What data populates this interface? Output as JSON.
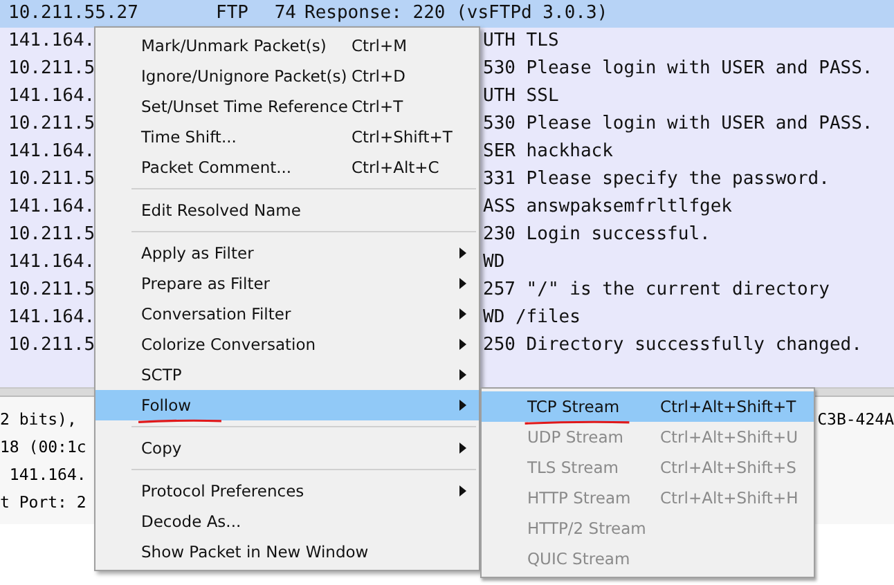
{
  "packet_list": {
    "rows": [
      {
        "source": "10.211.55.27",
        "protocol": "FTP",
        "length": "74",
        "info": "Response: 220 (vsFTPd 3.0.3)",
        "selected": true
      },
      {
        "source": "141.164.",
        "info": "UTH TLS",
        "selected": false
      },
      {
        "source": "10.211.5",
        "info": "530 Please login with USER and PASS.",
        "selected": false
      },
      {
        "source": "141.164.",
        "info": "UTH SSL",
        "selected": false
      },
      {
        "source": "10.211.5",
        "info": "530 Please login with USER and PASS.",
        "selected": false
      },
      {
        "source": "141.164.",
        "info": "SER hackhack",
        "selected": false
      },
      {
        "source": "10.211.5",
        "info": "331 Please specify the password.",
        "selected": false
      },
      {
        "source": "141.164.",
        "info": "ASS answpaksemfrltlfgek",
        "selected": false
      },
      {
        "source": "10.211.5",
        "info": "230 Login successful.",
        "selected": false
      },
      {
        "source": "141.164.",
        "info": "WD",
        "selected": false
      },
      {
        "source": "10.211.5",
        "info": "257 \"/\" is the current directory",
        "selected": false
      },
      {
        "source": "141.164.",
        "info": "WD /files",
        "selected": false
      },
      {
        "source": "10.211.5",
        "info": "250 Directory successfully changed.",
        "selected": false
      }
    ]
  },
  "details_pane": {
    "lines": [
      {
        "column_1": "2 bits),",
        "column_2": "C3B-424A"
      },
      {
        "column_1": "18 (00:1c"
      },
      {
        "column_1": " 141.164."
      },
      {
        "column_1": "t Port: 2"
      }
    ]
  },
  "context_menu": {
    "items": [
      {
        "kind": "item",
        "label": "Mark/Unmark Packet(s)",
        "shortcut": "Ctrl+M",
        "submenu": false,
        "selected": false,
        "underlined": false
      },
      {
        "kind": "item",
        "label": "Ignore/Unignore Packet(s)",
        "shortcut": "Ctrl+D",
        "submenu": false,
        "selected": false,
        "underlined": false
      },
      {
        "kind": "item",
        "label": "Set/Unset Time Reference",
        "shortcut": "Ctrl+T",
        "submenu": false,
        "selected": false,
        "underlined": false
      },
      {
        "kind": "item",
        "label": "Time Shift...",
        "shortcut": "Ctrl+Shift+T",
        "submenu": false,
        "selected": false,
        "underlined": false
      },
      {
        "kind": "item",
        "label": "Packet Comment...",
        "shortcut": "Ctrl+Alt+C",
        "submenu": false,
        "selected": false,
        "underlined": false
      },
      {
        "kind": "separator"
      },
      {
        "kind": "item",
        "label": "Edit Resolved Name",
        "submenu": false,
        "selected": false,
        "underlined": false
      },
      {
        "kind": "separator"
      },
      {
        "kind": "item",
        "label": "Apply as Filter",
        "submenu": true,
        "selected": false,
        "underlined": false
      },
      {
        "kind": "item",
        "label": "Prepare as Filter",
        "submenu": true,
        "selected": false,
        "underlined": false
      },
      {
        "kind": "item",
        "label": "Conversation Filter",
        "submenu": true,
        "selected": false,
        "underlined": false
      },
      {
        "kind": "item",
        "label": "Colorize Conversation",
        "submenu": true,
        "selected": false,
        "underlined": false
      },
      {
        "kind": "item",
        "label": "SCTP",
        "submenu": true,
        "selected": false,
        "underlined": false
      },
      {
        "kind": "item",
        "label": "Follow",
        "submenu": true,
        "selected": true,
        "underlined": true
      },
      {
        "kind": "separator"
      },
      {
        "kind": "item",
        "label": "Copy",
        "submenu": true,
        "selected": false,
        "underlined": false
      },
      {
        "kind": "separator"
      },
      {
        "kind": "item",
        "label": "Protocol Preferences",
        "submenu": true,
        "selected": false,
        "underlined": false
      },
      {
        "kind": "item",
        "label": "Decode As...",
        "submenu": false,
        "selected": false,
        "underlined": false
      },
      {
        "kind": "item",
        "label": "Show Packet in New Window",
        "submenu": false,
        "selected": false,
        "underlined": false
      }
    ]
  },
  "follow_submenu": {
    "items": [
      {
        "label": "TCP Stream",
        "shortcut": "Ctrl+Alt+Shift+T",
        "selected": true,
        "disabled": false,
        "underlined": true
      },
      {
        "label": "UDP Stream",
        "shortcut": "Ctrl+Alt+Shift+U",
        "selected": false,
        "disabled": true,
        "underlined": false
      },
      {
        "label": "TLS Stream",
        "shortcut": "Ctrl+Alt+Shift+S",
        "selected": false,
        "disabled": true,
        "underlined": false
      },
      {
        "label": "HTTP Stream",
        "shortcut": "Ctrl+Alt+Shift+H",
        "selected": false,
        "disabled": true,
        "underlined": false
      },
      {
        "label": "HTTP/2 Stream",
        "selected": false,
        "disabled": true,
        "underlined": false
      },
      {
        "label": "QUIC Stream",
        "selected": false,
        "disabled": true,
        "underlined": false
      }
    ]
  }
}
